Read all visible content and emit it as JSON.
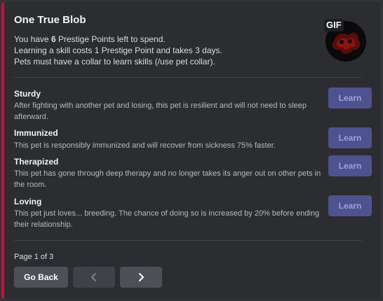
{
  "embed": {
    "accent_color": "#c8102e",
    "title": "One True Blob",
    "description": {
      "line1_prefix": "You have ",
      "points": "6",
      "line1_suffix": " Prestige Points left to spend.",
      "line2": "Learning a skill costs 1 Prestige Point and takes 3 days.",
      "line3": "Pets must have a collar to learn skills (/use pet collar)."
    },
    "thumbnail": {
      "badge": "GIF",
      "icon": "blob-pet-icon"
    }
  },
  "skills": [
    {
      "name": "Sturdy",
      "description": "After fighting with another pet and losing, this pet is resilient and will not need to sleep afterward.",
      "button": "Learn"
    },
    {
      "name": "Immunized",
      "description": "This pet is responsibly immunized and will recover from sickness 75% faster.",
      "button": "Learn"
    },
    {
      "name": "Therapized",
      "description": "This pet has gone through deep therapy and no longer takes its anger out on other pets in the room.",
      "button": "Learn"
    },
    {
      "name": "Loving",
      "description": "This pet just loves... breeding. The chance of doing so is increased by 20% before ending their relationship.",
      "button": "Learn"
    }
  ],
  "footer": {
    "page_text": "Page 1 of 3",
    "go_back": "Go Back",
    "prev_icon": "chevron-left-icon",
    "next_icon": "chevron-right-icon"
  }
}
